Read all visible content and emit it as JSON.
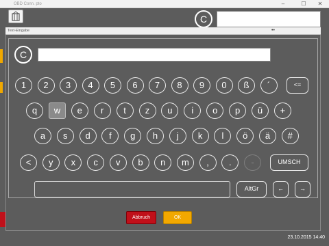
{
  "app": {
    "title": "OBD Conn. pto",
    "window_controls": [
      "–",
      "☐",
      "✕"
    ],
    "clear_symbol": "C",
    "status_time": "23.10.2015 14:40"
  },
  "dialog": {
    "title": "Text-Eingabe",
    "grip": "••",
    "clear_symbol": "C",
    "input_value": "",
    "buttons": {
      "cancel": "Abbruch",
      "ok": "OK"
    }
  },
  "keyboard": {
    "row1": [
      "1",
      "2",
      "3",
      "4",
      "5",
      "6",
      "7",
      "8",
      "9",
      "0",
      "ß",
      "´",
      "<="
    ],
    "row2": [
      "q",
      "w",
      "e",
      "r",
      "t",
      "z",
      "u",
      "i",
      "o",
      "p",
      "ü",
      "+"
    ],
    "row3": [
      "a",
      "s",
      "d",
      "f",
      "g",
      "h",
      "j",
      "k",
      "l",
      "ö",
      "ä",
      "#"
    ],
    "row4": [
      "<",
      "y",
      "x",
      "c",
      "v",
      "b",
      "n",
      "m",
      ",",
      ".",
      "-",
      "UMSCH"
    ],
    "row5": [
      "AltGr",
      "←",
      "→"
    ],
    "selected_key": "w"
  },
  "colors": {
    "accent_cancel": "#c0101a",
    "accent_ok": "#f2a800",
    "background": "#5c5c5c"
  }
}
